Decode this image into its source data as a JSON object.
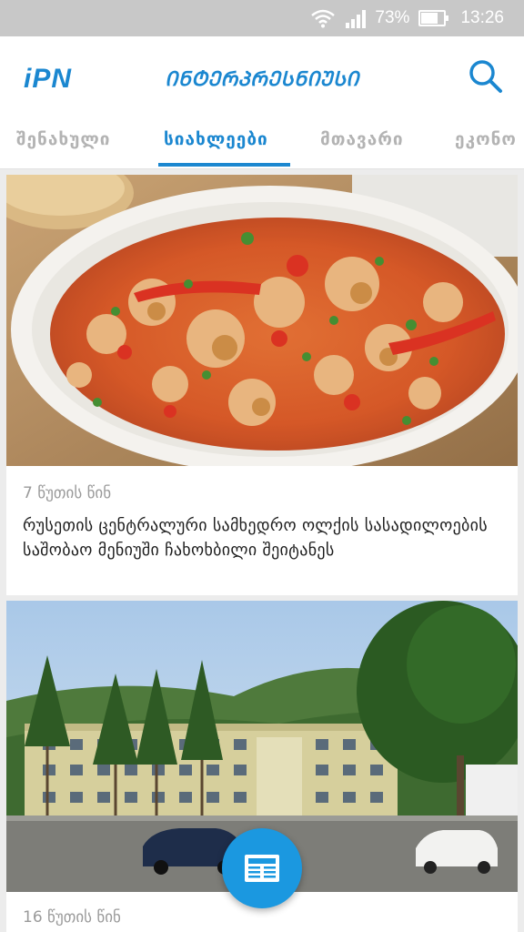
{
  "status_bar": {
    "battery": "73%",
    "time": "13:26",
    "battery_level": 0.73
  },
  "header": {
    "logo": "iPN",
    "brand": "ᲘᲜᲢᲔᲠᲞᲠᲔᲡᲜᲘᲣᲡᲘ"
  },
  "tabs": [
    {
      "label": "შენახული"
    },
    {
      "label": "სიახლეები"
    },
    {
      "label": "მთავარი"
    },
    {
      "label": "ეკონო"
    }
  ],
  "articles": [
    {
      "time": "7 წუთის წინ",
      "title": "რუსეთის ცენტრალური სამხედრო ოლქის სასადილოების საშობაო მენიუში ჩახოხბილი შეიტანეს"
    },
    {
      "time": "16 წუთის წინ",
      "title": ""
    }
  ],
  "colors": {
    "accent": "#1b87d0",
    "fab": "#1b98e0"
  }
}
